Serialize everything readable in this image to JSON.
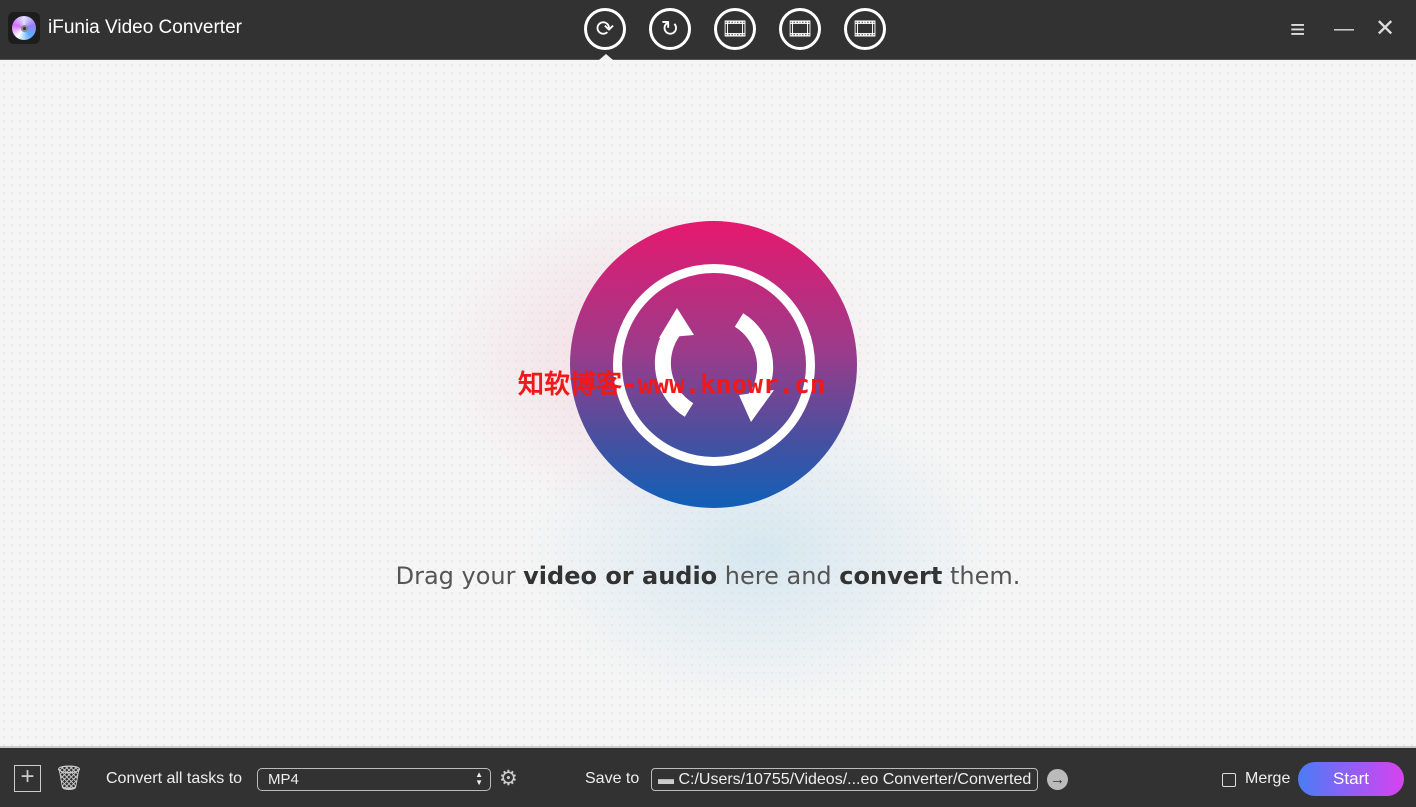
{
  "app": {
    "title": "iFunia Video Converter"
  },
  "toolbar": {
    "modes": [
      {
        "name": "convert",
        "icon": "convert-icon",
        "active": true
      },
      {
        "name": "rotate",
        "icon": "rotate-icon"
      },
      {
        "name": "download",
        "icon": "film-download-icon"
      },
      {
        "name": "compress",
        "icon": "film-compress-icon"
      },
      {
        "name": "edit",
        "icon": "film-edit-icon"
      }
    ]
  },
  "window": {
    "menu": "≡",
    "minimize": "—",
    "close": "✕"
  },
  "main": {
    "watermark": "知软博客-www.knowr.cn",
    "drop_text": {
      "p1": "Drag your ",
      "b1": "video or audio",
      "p2": " here and ",
      "b2": "convert",
      "p3": " them."
    }
  },
  "bottom": {
    "convert_label": "Convert all tasks to",
    "format": "MP4",
    "save_label": "Save to",
    "save_path": "C:/Users/10755/Videos/...eo Converter/Converted",
    "merge_label": "Merge",
    "merge_checked": false,
    "start_label": "Start"
  },
  "colors": {
    "accent_start": "#4a7cf6",
    "accent_end": "#d842f0",
    "titlebar": "#323232"
  }
}
